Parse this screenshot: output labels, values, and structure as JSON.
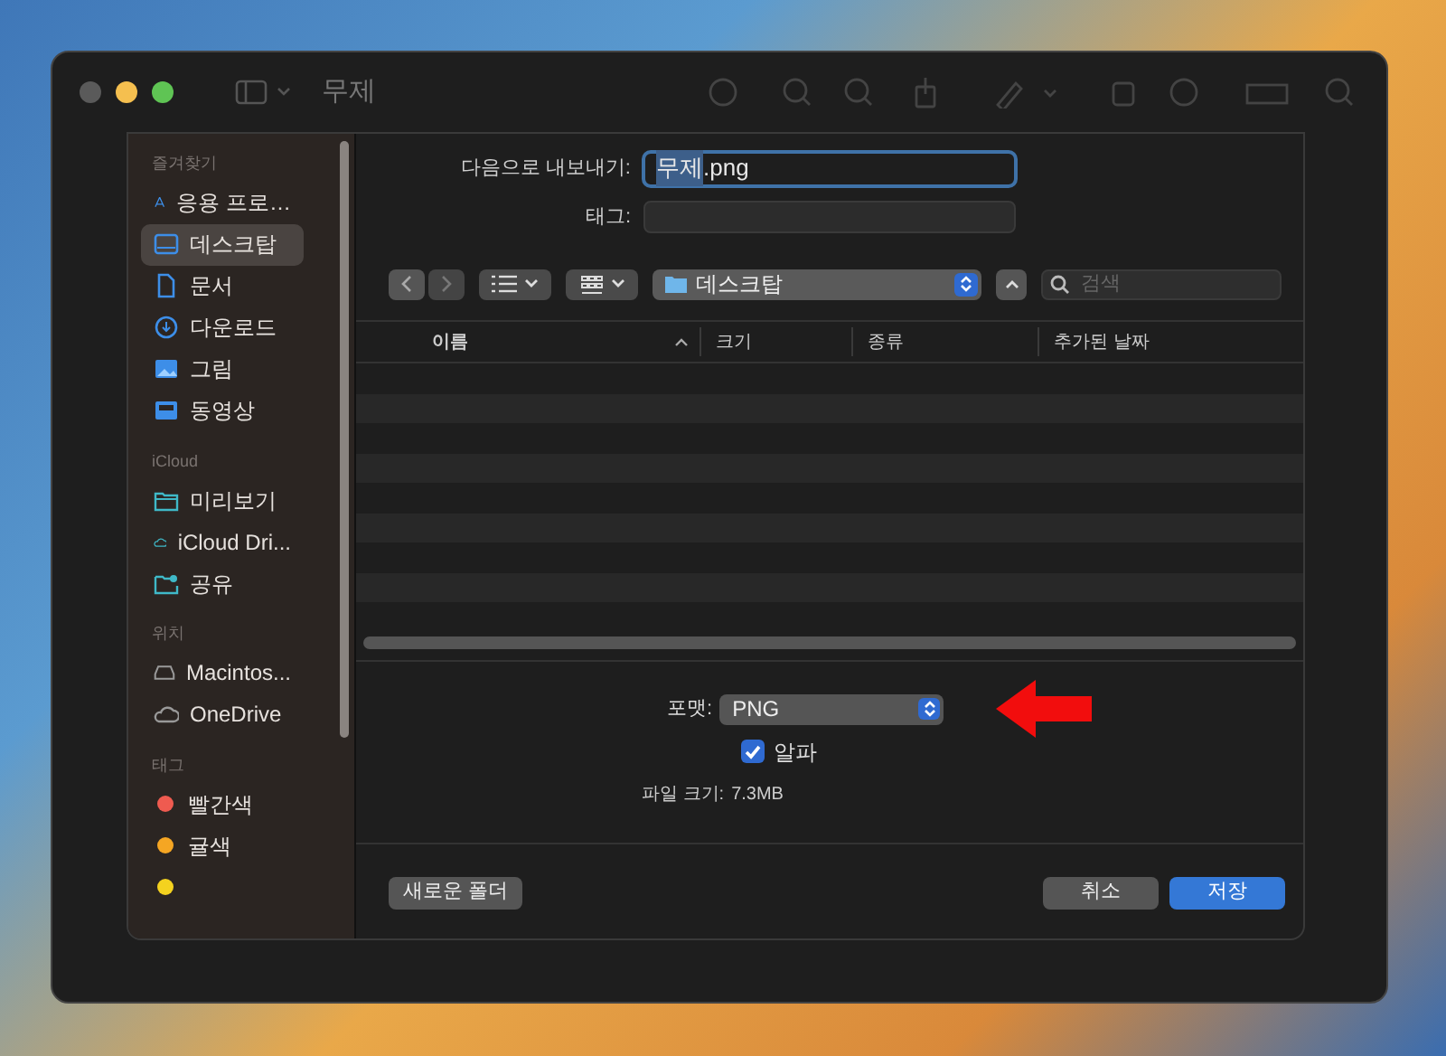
{
  "window": {
    "title": "무제"
  },
  "sidebar": {
    "sections": [
      {
        "heading": "즐겨찾기",
        "items": [
          {
            "label": "응용 프로…",
            "selected": false
          },
          {
            "label": "데스크탑",
            "selected": true
          },
          {
            "label": "문서",
            "selected": false
          },
          {
            "label": "다운로드",
            "selected": false
          },
          {
            "label": "그림",
            "selected": false
          },
          {
            "label": "동영상",
            "selected": false
          }
        ]
      },
      {
        "heading": "iCloud",
        "items": [
          {
            "label": "미리보기",
            "selected": false
          },
          {
            "label": "iCloud Dri...",
            "selected": false
          },
          {
            "label": "공유",
            "selected": false
          }
        ]
      },
      {
        "heading": "위치",
        "items": [
          {
            "label": "Macintos...",
            "selected": false
          },
          {
            "label": "OneDrive",
            "selected": false
          }
        ]
      },
      {
        "heading": "태그",
        "items": [
          {
            "label": "빨간색",
            "color": "#ef5b50",
            "selected": false
          },
          {
            "label": "귤색",
            "color": "#f5a623",
            "selected": false
          },
          {
            "color": "#f4d21f",
            "selected": false
          }
        ]
      }
    ]
  },
  "export": {
    "label": "다음으로 내보내기:",
    "value_selected": "무제",
    "value_rest": ".png"
  },
  "tags": {
    "label": "태그:"
  },
  "location": {
    "folder": "데스크탑"
  },
  "search": {
    "placeholder": "검색"
  },
  "table": {
    "columns": [
      {
        "label": "이름",
        "sorted": true
      },
      {
        "label": "크기",
        "sorted": false
      },
      {
        "label": "종류",
        "sorted": false
      },
      {
        "label": "추가된 날짜",
        "sorted": false
      }
    ]
  },
  "format": {
    "label": "포맷:",
    "value": "PNG"
  },
  "alpha": {
    "label": "알파",
    "checked": true
  },
  "file_size": {
    "label": "파일 크기:",
    "value": "7.3MB"
  },
  "buttons": {
    "new_folder": "새로운 폴더",
    "cancel": "취소",
    "save": "저장"
  }
}
